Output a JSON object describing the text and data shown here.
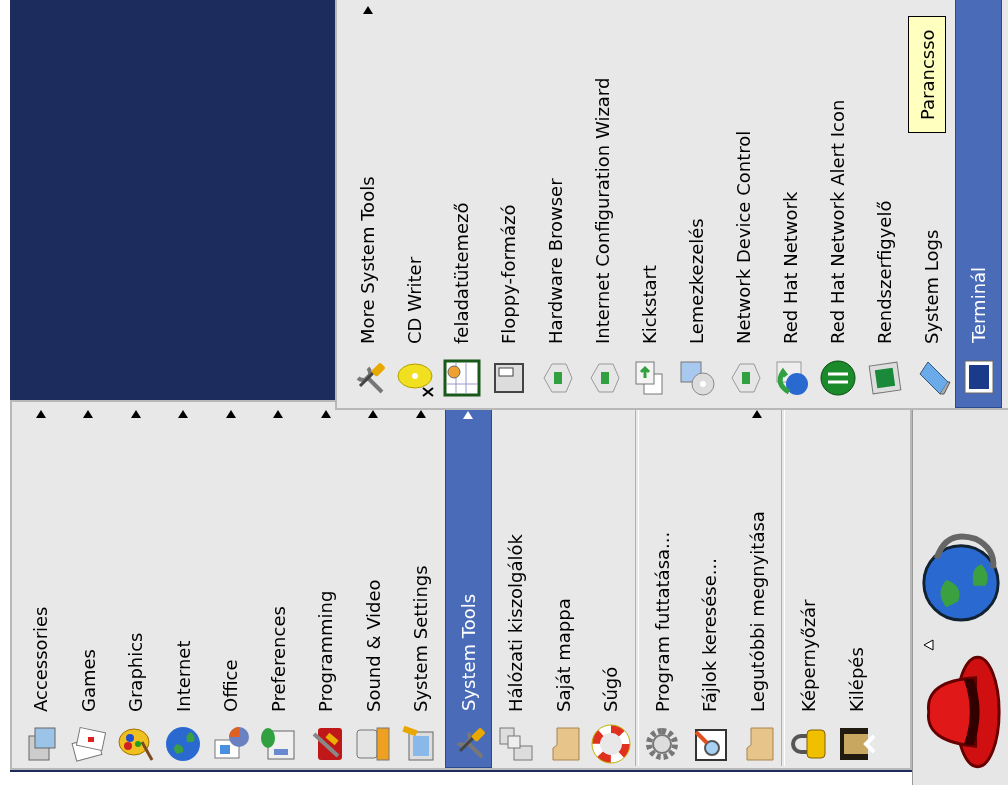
{
  "main_menu": {
    "groups": [
      {
        "items": [
          {
            "label": "Accessories",
            "has_submenu": true,
            "selected": false
          },
          {
            "label": "Games",
            "has_submenu": true,
            "selected": false
          },
          {
            "label": "Graphics",
            "has_submenu": true,
            "selected": false
          },
          {
            "label": "Internet",
            "has_submenu": true,
            "selected": false
          },
          {
            "label": "Office",
            "has_submenu": true,
            "selected": false
          },
          {
            "label": "Preferences",
            "has_submenu": true,
            "selected": false
          },
          {
            "label": "Programming",
            "has_submenu": true,
            "selected": false
          },
          {
            "label": "Sound & Video",
            "has_submenu": true,
            "selected": false
          },
          {
            "label": "System Settings",
            "has_submenu": true,
            "selected": false
          },
          {
            "label": "System Tools",
            "has_submenu": true,
            "selected": true
          },
          {
            "label": "Hálózati kiszolgálók",
            "has_submenu": false,
            "selected": false
          },
          {
            "label": "Saját mappa",
            "has_submenu": false,
            "selected": false
          },
          {
            "label": "Súgó",
            "has_submenu": false,
            "selected": false
          }
        ]
      },
      {
        "items": [
          {
            "label": "Program futtatása...",
            "has_submenu": false,
            "selected": false
          },
          {
            "label": "Fájlok keresése...",
            "has_submenu": false,
            "selected": false
          },
          {
            "label": "Legutóbbi megnyitása",
            "has_submenu": true,
            "selected": false
          }
        ]
      },
      {
        "items": [
          {
            "label": "Képernyőzár",
            "has_submenu": false,
            "selected": false
          },
          {
            "label": "Kilépés",
            "has_submenu": false,
            "selected": false
          }
        ]
      }
    ]
  },
  "submenu": {
    "items": [
      {
        "label": "More System Tools",
        "has_submenu": true,
        "selected": false
      },
      {
        "label": "CD Writer",
        "has_submenu": false,
        "selected": false
      },
      {
        "label": "feladatütemező",
        "has_submenu": false,
        "selected": false
      },
      {
        "label": "Floppy-formázó",
        "has_submenu": false,
        "selected": false
      },
      {
        "label": "Hardware Browser",
        "has_submenu": false,
        "selected": false
      },
      {
        "label": "Internet Configuration Wizard",
        "has_submenu": false,
        "selected": false
      },
      {
        "label": "Kickstart",
        "has_submenu": false,
        "selected": false
      },
      {
        "label": "Lemezkezelés",
        "has_submenu": false,
        "selected": false
      },
      {
        "label": "Network Device Control",
        "has_submenu": false,
        "selected": false
      },
      {
        "label": "Red Hat Network",
        "has_submenu": false,
        "selected": false
      },
      {
        "label": "Red Hat Network Alert Icon",
        "has_submenu": false,
        "selected": false
      },
      {
        "label": "Rendszerfigyelő",
        "has_submenu": false,
        "selected": false
      },
      {
        "label": "System Logs",
        "has_submenu": false,
        "selected": false
      },
      {
        "label": "Terminál",
        "has_submenu": false,
        "selected": true
      }
    ]
  },
  "tooltip": {
    "text": "Parancsso"
  }
}
